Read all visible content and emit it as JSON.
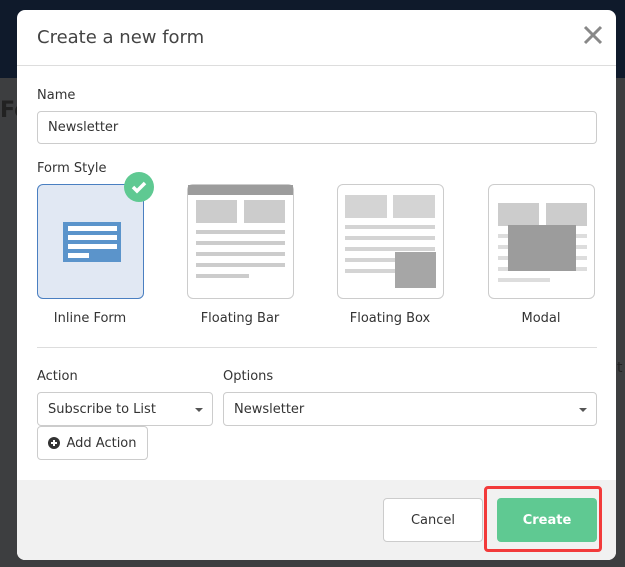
{
  "background": {
    "heading_fragment": "Fo",
    "right_fragment": "t"
  },
  "modal": {
    "title": "Create a new form",
    "close_icon": "close-icon",
    "name_label": "Name",
    "name_value": "Newsletter",
    "form_style_label": "Form Style",
    "styles": [
      {
        "label": "Inline Form",
        "selected": true
      },
      {
        "label": "Floating Bar",
        "selected": false
      },
      {
        "label": "Floating Box",
        "selected": false
      },
      {
        "label": "Modal",
        "selected": false
      }
    ],
    "action_label": "Action",
    "action_value": "Subscribe to List",
    "options_label": "Options",
    "options_value": "Newsletter",
    "add_action_label": "Add Action",
    "cancel_label": "Cancel",
    "create_label": "Create"
  },
  "colors": {
    "accent_green": "#5fc992",
    "selected_blue": "#5b94cb",
    "highlight_red": "#f23a3a"
  }
}
